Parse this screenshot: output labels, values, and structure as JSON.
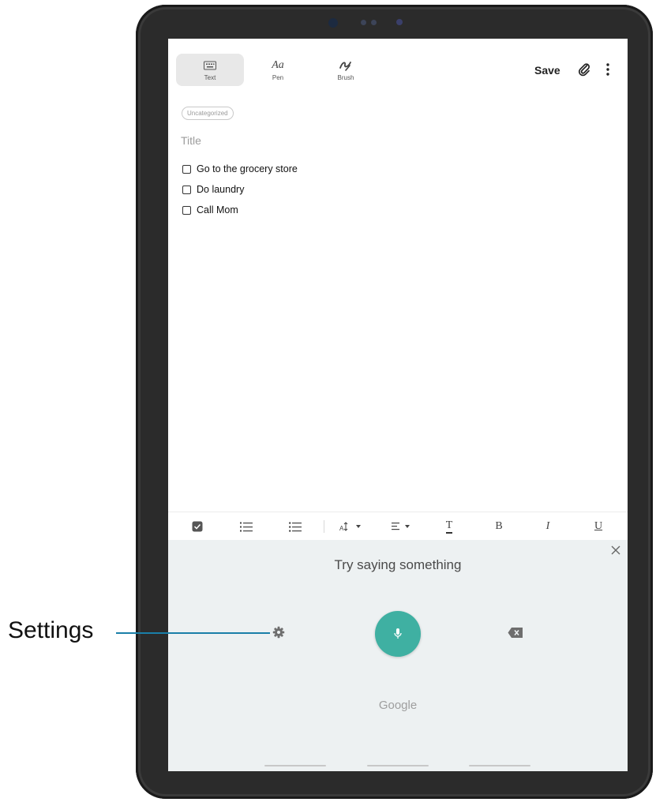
{
  "toolbar": {
    "modes": [
      {
        "label": "Text",
        "icon": "keyboard-icon",
        "active": true
      },
      {
        "label": "Pen",
        "icon": "pen-aa-icon",
        "active": false
      },
      {
        "label": "Brush",
        "icon": "brush-icon",
        "active": false
      }
    ],
    "save_label": "Save",
    "attach_icon": "paperclip-icon",
    "more_icon": "more-vertical-icon"
  },
  "note": {
    "category": "Uncategorized",
    "title_placeholder": "Title",
    "checklist": [
      {
        "text": "Go to the grocery store",
        "checked": false
      },
      {
        "text": "Do laundry",
        "checked": false
      },
      {
        "text": "Call Mom",
        "checked": false
      }
    ]
  },
  "format_bar": {
    "items": [
      "checkbox-icon",
      "numbered-list-icon",
      "bullet-list-icon",
      "font-size-icon",
      "align-icon",
      "text-color-icon",
      "bold-icon",
      "italic-icon",
      "underline-icon"
    ],
    "bold": "B",
    "italic": "I",
    "underline": "U",
    "text_color": "T"
  },
  "voice_input": {
    "prompt": "Try saying something",
    "brand": "Google",
    "mic_color": "#3fb0a2",
    "panel_color": "#edf1f2"
  },
  "callout": {
    "label": "Settings",
    "line_color": "#1a7fa8"
  }
}
